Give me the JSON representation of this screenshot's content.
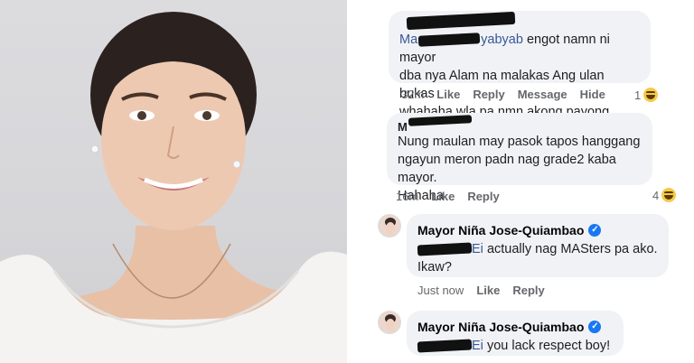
{
  "comments": [
    {
      "author_redacted": true,
      "mention_visible": "Ma",
      "mention_tail": "yabyab",
      "text_line1": "engot namn ni mayor",
      "text_line2": "dba nya Alam na malakas Ang ulan bukas",
      "text_line3": "whahaha wla pa nmn akong payong hahah",
      "time": "32m",
      "actions": [
        "Like",
        "Reply",
        "Message",
        "Hide"
      ],
      "reaction_count": "1"
    },
    {
      "author_redacted": true,
      "author_visible": "M",
      "text_line1": "Nung maulan may pasok tapos hanggang",
      "text_line2": "ngayun meron padn nag grade2 kaba mayor.",
      "text_line3": "Hahaha",
      "time": "16m",
      "actions": [
        "Like",
        "Reply"
      ],
      "reaction_count": "4"
    },
    {
      "author": "Mayor Niña Jose-Quiambao",
      "mention_tail": "Ei",
      "text_line1": "actually nag MASters pa ako.",
      "text_line2": "Ikaw?",
      "time": "Just now",
      "actions": [
        "Like",
        "Reply"
      ]
    },
    {
      "author": "Mayor Niña Jose-Quiambao",
      "mention_tail": "Ei",
      "text_line1": "you lack respect boy!"
    }
  ],
  "icons": {
    "verified": "verified-badge-icon",
    "reaction": "laughing-emoji-icon"
  },
  "colors": {
    "bubble": "#f0f2f5",
    "mention": "#385898",
    "meta": "#65676b",
    "verified": "#1877f2"
  }
}
